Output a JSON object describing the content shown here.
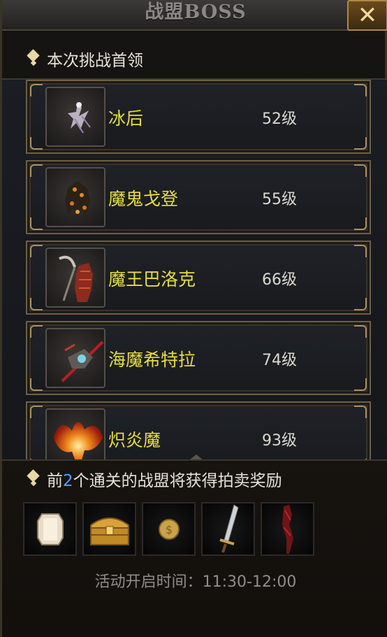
{
  "window": {
    "title": "战盟BOSS",
    "close_label": "✕"
  },
  "challenge_section": {
    "title": "本次挑战首领"
  },
  "bosses": [
    {
      "name": "冰后",
      "level": "52级",
      "icon": "ice-queen-portrait-icon"
    },
    {
      "name": "魔鬼戈登",
      "level": "55级",
      "icon": "demon-gordon-portrait-icon"
    },
    {
      "name": "魔王巴洛克",
      "level": "66级",
      "icon": "demon-king-balrog-portrait-icon"
    },
    {
      "name": "海魔希特拉",
      "level": "74级",
      "icon": "sea-demon-hydra-portrait-icon"
    },
    {
      "name": "炽炎魔",
      "level": "93级",
      "icon": "flame-demon-portrait-icon"
    }
  ],
  "reward_section": {
    "title_prefix": "前",
    "title_number": "2",
    "title_suffix": "个通关的战盟将获得拍卖奖励"
  },
  "rewards": [
    {
      "icon": "gem-icon"
    },
    {
      "icon": "treasure-chest-icon"
    },
    {
      "icon": "gold-coin-icon"
    },
    {
      "icon": "sword-icon"
    },
    {
      "icon": "red-staff-icon"
    }
  ],
  "event": {
    "time_label": "活动开启时间：11:30-12:00"
  },
  "colors": {
    "boss_name": "#e7dc3e",
    "highlight_number": "#4aa3ff",
    "frame_gold": "#6f5f43"
  }
}
